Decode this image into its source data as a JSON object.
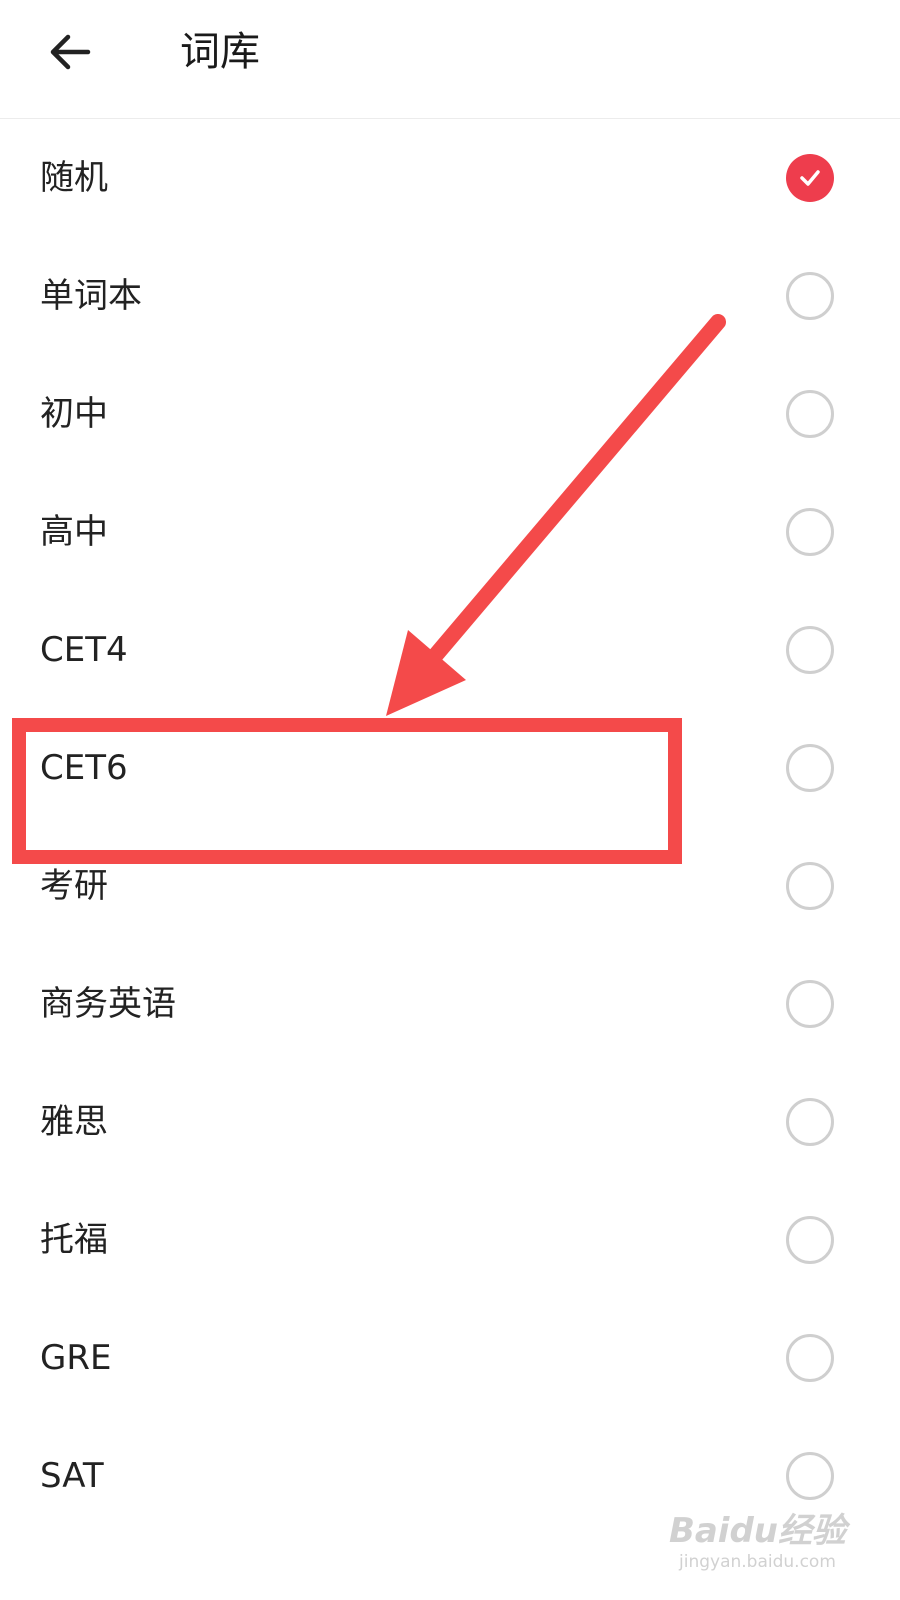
{
  "header": {
    "title": "词库",
    "back_icon": "arrow-left-icon"
  },
  "wordbanks": [
    {
      "label": "随机",
      "selected": true
    },
    {
      "label": "单词本",
      "selected": false
    },
    {
      "label": "初中",
      "selected": false
    },
    {
      "label": "高中",
      "selected": false
    },
    {
      "label": "CET4",
      "selected": false
    },
    {
      "label": "CET6",
      "selected": false
    },
    {
      "label": "考研",
      "selected": false
    },
    {
      "label": "商务英语",
      "selected": false
    },
    {
      "label": "雅思",
      "selected": false
    },
    {
      "label": "托福",
      "selected": false
    },
    {
      "label": "GRE",
      "selected": false
    },
    {
      "label": "SAT",
      "selected": false
    }
  ],
  "colors": {
    "accent": "#ee3d4d",
    "radio_border": "#cfcfcf",
    "annotation": "#f44a4a"
  },
  "watermark": {
    "logo": "Baidu经验",
    "url": "jingyan.baidu.com"
  }
}
